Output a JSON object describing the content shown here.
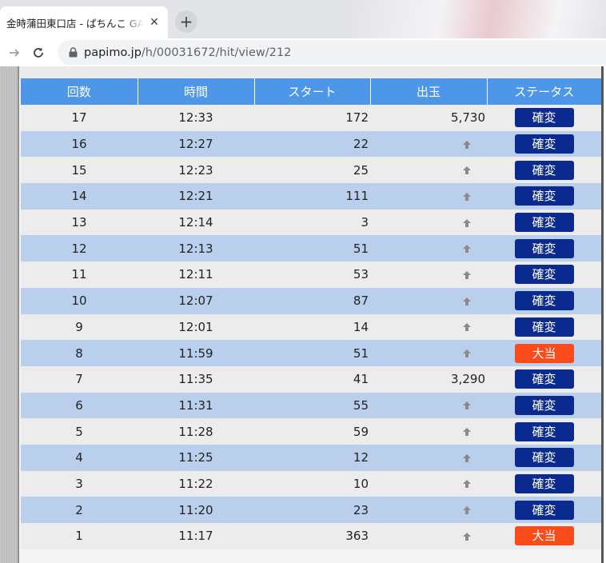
{
  "browser": {
    "tab_title": "金時蒲田東口店 - ぱちんこ GAN",
    "url_host": "papimo.jp",
    "url_path": "/h/00031672/hit/view/212"
  },
  "table": {
    "headers": [
      "回数",
      "時間",
      "スタート",
      "出玉",
      "ステータス"
    ],
    "rows": [
      {
        "num": "17",
        "time": "12:33",
        "start": "172",
        "out": "5,730",
        "status": "確変",
        "type": "kakuhen"
      },
      {
        "num": "16",
        "time": "12:27",
        "start": "22",
        "out": "",
        "status": "確変",
        "type": "kakuhen"
      },
      {
        "num": "15",
        "time": "12:23",
        "start": "25",
        "out": "",
        "status": "確変",
        "type": "kakuhen"
      },
      {
        "num": "14",
        "time": "12:21",
        "start": "111",
        "out": "",
        "status": "確変",
        "type": "kakuhen"
      },
      {
        "num": "13",
        "time": "12:14",
        "start": "3",
        "out": "",
        "status": "確変",
        "type": "kakuhen"
      },
      {
        "num": "12",
        "time": "12:13",
        "start": "51",
        "out": "",
        "status": "確変",
        "type": "kakuhen"
      },
      {
        "num": "11",
        "time": "12:11",
        "start": "53",
        "out": "",
        "status": "確変",
        "type": "kakuhen"
      },
      {
        "num": "10",
        "time": "12:07",
        "start": "87",
        "out": "",
        "status": "確変",
        "type": "kakuhen"
      },
      {
        "num": "9",
        "time": "12:01",
        "start": "14",
        "out": "",
        "status": "確変",
        "type": "kakuhen"
      },
      {
        "num": "8",
        "time": "11:59",
        "start": "51",
        "out": "",
        "status": "大当",
        "type": "ooatari"
      },
      {
        "num": "7",
        "time": "11:35",
        "start": "41",
        "out": "3,290",
        "status": "確変",
        "type": "kakuhen"
      },
      {
        "num": "6",
        "time": "11:31",
        "start": "55",
        "out": "",
        "status": "確変",
        "type": "kakuhen"
      },
      {
        "num": "5",
        "time": "11:28",
        "start": "59",
        "out": "",
        "status": "確変",
        "type": "kakuhen"
      },
      {
        "num": "4",
        "time": "11:25",
        "start": "12",
        "out": "",
        "status": "確変",
        "type": "kakuhen"
      },
      {
        "num": "3",
        "time": "11:22",
        "start": "10",
        "out": "",
        "status": "確変",
        "type": "kakuhen"
      },
      {
        "num": "2",
        "time": "11:20",
        "start": "23",
        "out": "",
        "status": "確変",
        "type": "kakuhen"
      },
      {
        "num": "1",
        "time": "11:17",
        "start": "363",
        "out": "",
        "status": "大当",
        "type": "ooatari"
      }
    ]
  },
  "icons": {
    "up_arrow": "up-arrow-icon",
    "lock": "lock-icon",
    "reload": "reload-icon",
    "forward": "forward-arrow-icon",
    "close": "close-icon",
    "new_tab": "plus-icon"
  },
  "colors": {
    "header_bg": "#4d96e8",
    "row_odd": "#ececec",
    "row_even": "#b9cfec",
    "kakuhen": "#0b2a8f",
    "ooatari": "#fa4c1b"
  }
}
